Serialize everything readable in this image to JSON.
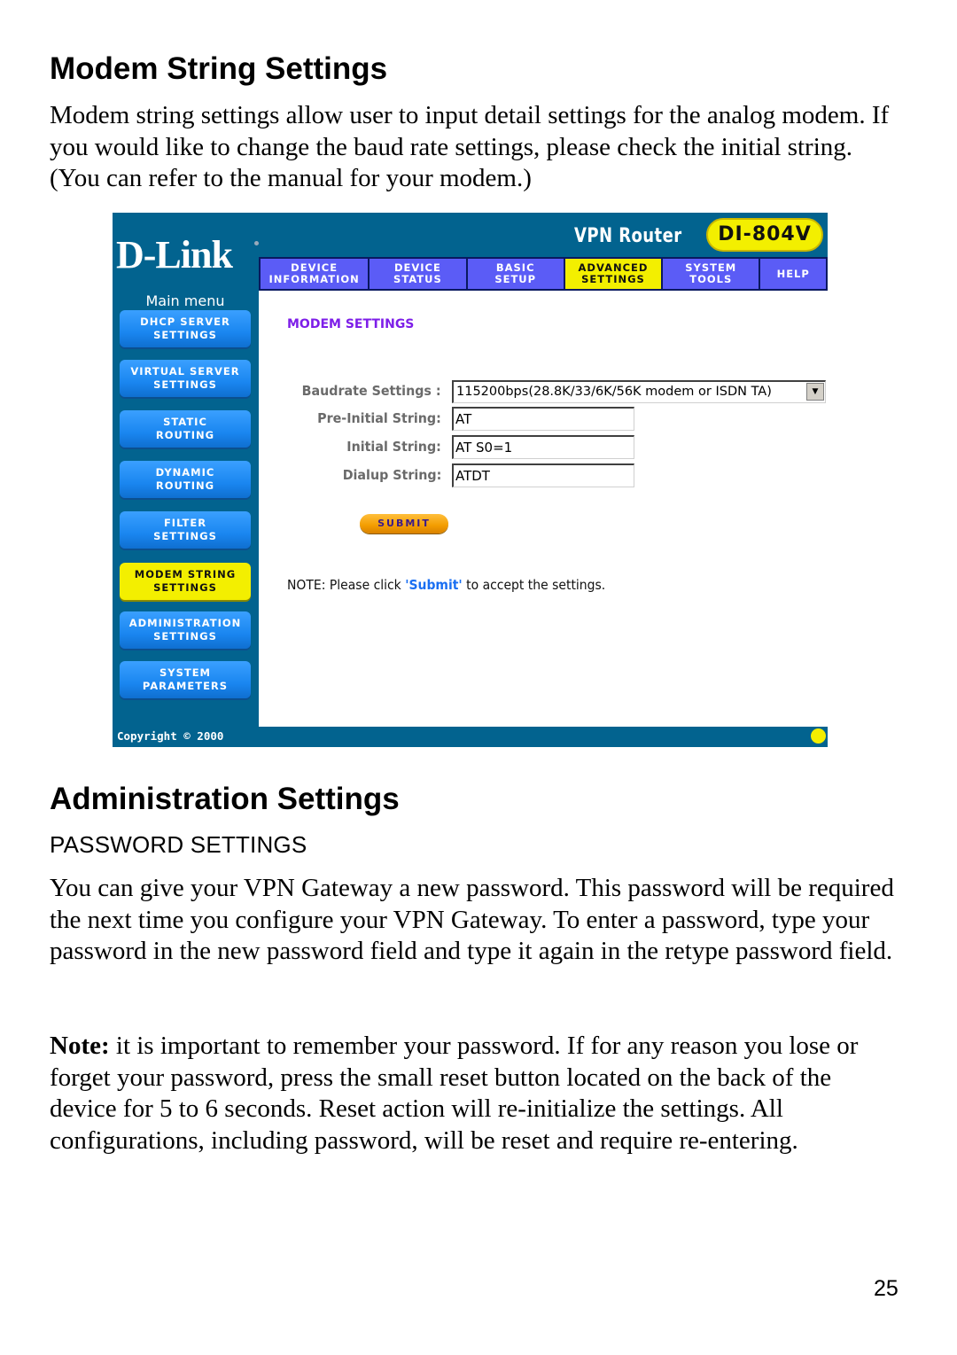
{
  "section1": {
    "title": "Modem String Settings",
    "body": "Modem string settings allow user to input detail settings for the analog modem. If you would like to change the baud rate settings, please check the initial string. (You can refer to the manual for your modem.)"
  },
  "router_ui": {
    "logo": "D-Link",
    "product_name": "VPN Router",
    "model": "DI-804V",
    "nav_tabs": [
      {
        "label": "DEVICE\nINFORMATION",
        "active": false
      },
      {
        "label": "DEVICE\nSTATUS",
        "active": false
      },
      {
        "label": "BASIC\nSETUP",
        "active": false
      },
      {
        "label": "ADVANCED\nSETTINGS",
        "active": true
      },
      {
        "label": "SYSTEM\nTOOLS",
        "active": false
      },
      {
        "label": "HELP",
        "active": false
      }
    ],
    "sidebar": {
      "title": "Main menu",
      "items": [
        {
          "label": "DHCP SERVER\nSETTINGS",
          "active": false
        },
        {
          "label": "VIRTUAL SERVER\nSETTINGS",
          "active": false
        },
        {
          "label": "STATIC\nROUTING",
          "active": false
        },
        {
          "label": "DYNAMIC\nROUTING",
          "active": false
        },
        {
          "label": "FILTER\nSETTINGS",
          "active": false
        },
        {
          "label": "MODEM STRING\nSETTINGS",
          "active": true
        },
        {
          "label": "ADMINISTRATION\nSETTINGS",
          "active": false
        },
        {
          "label": "SYSTEM\nPARAMETERS",
          "active": false
        }
      ]
    },
    "content": {
      "section_title": "MODEM SETTINGS",
      "baudrate": {
        "label": "Baudrate Settings :",
        "value": "115200bps(28.8K/33/6K/56K modem or ISDN TA)"
      },
      "pre_initial": {
        "label": "Pre-Initial String:",
        "value": "AT"
      },
      "initial": {
        "label": "Initial String:",
        "value": "AT S0=1"
      },
      "dialup": {
        "label": "Dialup String:",
        "value": "ATDT"
      },
      "submit_label": "SUBMIT",
      "note_prefix": "NOTE: Please click ",
      "note_emphasis": "'Submit'",
      "note_suffix": " to accept the settings."
    },
    "footer": {
      "copyright": "Copyright © 2000"
    },
    "colors": {
      "frame": "#02638f",
      "tab": "#5b5cf6",
      "active": "#f3ef00",
      "section_title": "#7d1ee8",
      "link": "#1a6ff2"
    }
  },
  "section2": {
    "title": "Administration Settings",
    "subtitle": "PASSWORD SETTINGS",
    "body": "You can give your VPN Gateway a new password. This password will be required the next time you configure your VPN Gateway. To enter a password, type your password in the new password field and type it again in the retype password field.",
    "note_label": "Note:",
    "note_body": " it is important to remember your password. If for any reason you lose or forget your password, press the small reset button located on the back of the device for 5 to 6 seconds. Reset action will re-initialize the settings. All configurations, including password, will be reset and require re-entering."
  },
  "page_number": "25"
}
